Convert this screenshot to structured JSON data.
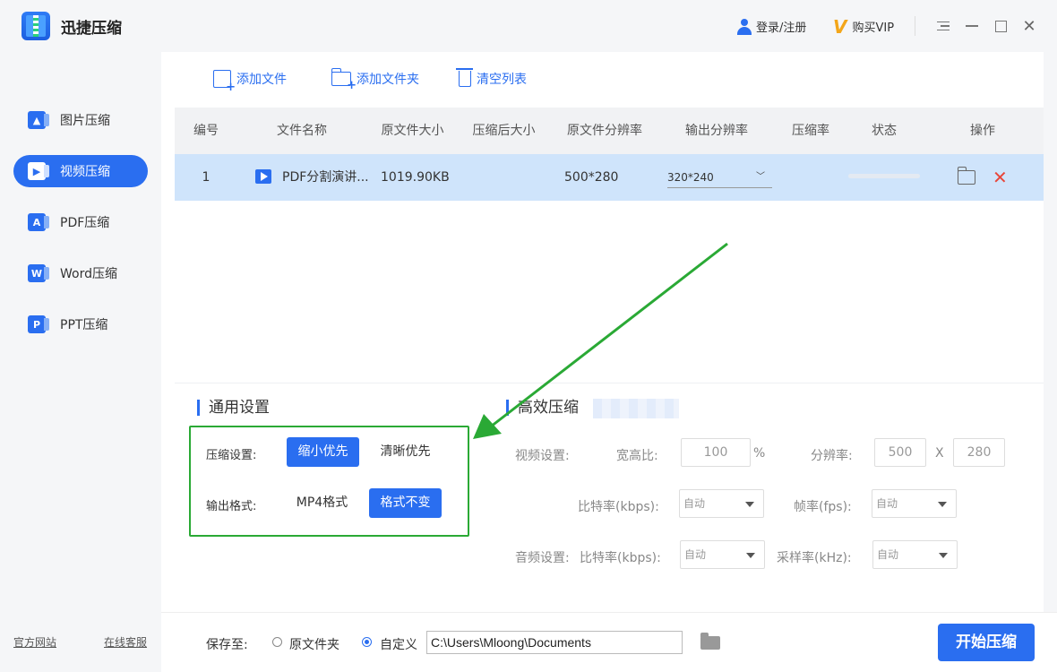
{
  "app": {
    "title": "迅捷压缩"
  },
  "header": {
    "login_label": "登录/注册",
    "vip_label": "购买VIP"
  },
  "sidebar": {
    "items": [
      {
        "label": "图片压缩",
        "active": false
      },
      {
        "label": "视频压缩",
        "active": true
      },
      {
        "label": "PDF压缩",
        "active": false
      },
      {
        "label": "Word压缩",
        "active": false
      },
      {
        "label": "PPT压缩",
        "active": false
      }
    ],
    "footer_links": [
      "官方网站",
      "在线客服"
    ]
  },
  "toolbar": {
    "add_file": "添加文件",
    "add_folder": "添加文件夹",
    "clear_list": "清空列表"
  },
  "table": {
    "columns": [
      "编号",
      "文件名称",
      "原文件大小",
      "压缩后大小",
      "原文件分辨率",
      "输出分辨率",
      "压缩率",
      "状态",
      "操作"
    ],
    "rows": [
      {
        "index": "1",
        "name": "PDF分割演讲...",
        "orig_size": "1019.90KB",
        "compressed_size": "",
        "orig_resolution": "500*280",
        "output_resolution": "320*240",
        "ratio": "",
        "progress": 0
      }
    ]
  },
  "general_settings": {
    "title": "通用设置",
    "compress_label": "压缩设置:",
    "compress_options": [
      "缩小优先",
      "清晰优先"
    ],
    "compress_selected": "缩小优先",
    "format_label": "输出格式:",
    "format_options": [
      "MP4格式",
      "格式不变"
    ],
    "format_selected": "格式不变"
  },
  "efficient": {
    "title": "高效压缩",
    "video_label": "视频设置:",
    "aspect_label": "宽高比:",
    "aspect_value": "100",
    "aspect_unit": "%",
    "resolution_label": "分辨率:",
    "res_w": "500",
    "res_sep": "X",
    "res_h": "280",
    "bitrate_label": "比特率(kbps):",
    "bitrate_value": "自动",
    "fps_label": "帧率(fps):",
    "fps_value": "自动",
    "audio_label": "音频设置:",
    "audio_bitrate_label": "比特率(kbps):",
    "audio_bitrate_value": "自动",
    "sample_label": "采样率(kHz):",
    "sample_value": "自动"
  },
  "footer": {
    "save_label": "保存至:",
    "option_original": "原文件夹",
    "option_custom": "自定义",
    "path": "C:\\Users\\Mloong\\Documents",
    "start_button": "开始压缩"
  },
  "colors": {
    "accent": "#2a6ef0",
    "highlight_box": "#2aa935",
    "delete": "#e8463a",
    "row_selected": "#cfe4fb"
  }
}
